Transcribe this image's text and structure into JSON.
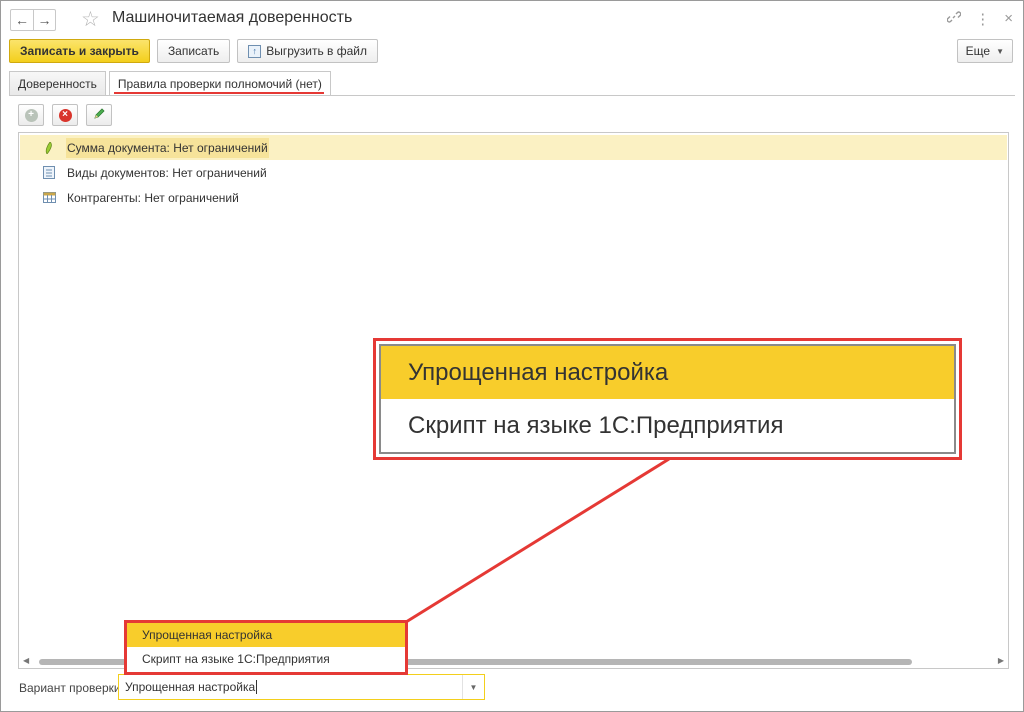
{
  "window": {
    "title": "Машиночитаемая доверенность"
  },
  "toolbar": {
    "save_close_label": "Записать и закрыть",
    "save_label": "Записать",
    "export_label": "Выгрузить в файл",
    "more_label": "Еще"
  },
  "tabs": [
    {
      "label": "Доверенность",
      "active": false
    },
    {
      "label": "Правила проверки полномочий (нет)",
      "active": true
    }
  ],
  "list": {
    "items": [
      {
        "label": "Сумма документа: Нет ограничений",
        "icon": "amount-icon",
        "selected": true
      },
      {
        "label": "Виды документов: Нет ограничений",
        "icon": "document-icon",
        "selected": false
      },
      {
        "label": "Контрагенты: Нет ограничений",
        "icon": "table-icon",
        "selected": false
      }
    ]
  },
  "dropdown": {
    "options": [
      {
        "label": "Упрощенная настройка",
        "selected": true
      },
      {
        "label": "Скрипт на языке 1С:Предприятия",
        "selected": false
      }
    ]
  },
  "zoom": {
    "options": [
      {
        "label": "Упрощенная настройка",
        "selected": true
      },
      {
        "label": "Скрипт на языке 1С:Предприятия",
        "selected": false
      }
    ]
  },
  "check_variant": {
    "label": "Вариант проверки:",
    "value": "Упрощенная настройка"
  },
  "colors": {
    "accent_yellow": "#f8cd2b",
    "highlight_red": "#e53935",
    "selected_row": "#fbf1c3"
  }
}
